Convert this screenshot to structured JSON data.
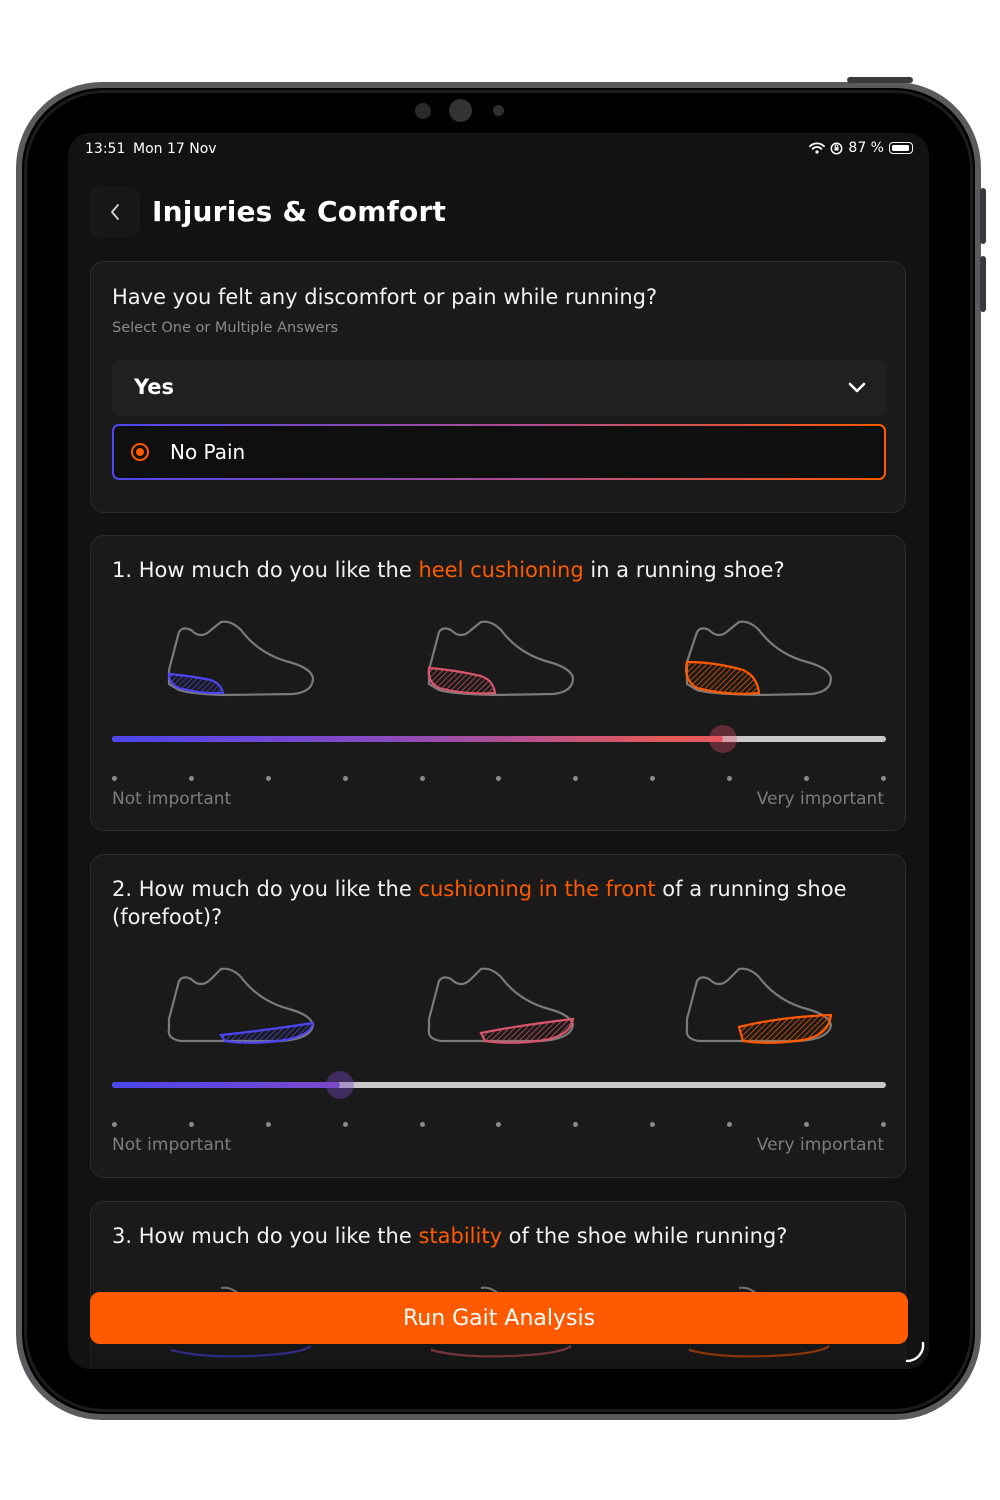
{
  "status_bar": {
    "time": "13:51",
    "date": "Mon 17 Nov",
    "battery": "87 %",
    "icons": [
      "wifi-icon",
      "orientation-lock-icon",
      "battery-icon"
    ]
  },
  "header": {
    "title": "Injuries & Comfort",
    "back_icon": "chevron-left-icon"
  },
  "pain_question": {
    "title": "Have you felt any discomfort or pain while running?",
    "subtitle": "Select One or Multiple Answers",
    "selected": "Yes",
    "option": "No Pain",
    "option_selected": true
  },
  "questions": [
    {
      "number": "1.",
      "pre": "How much do you like the ",
      "highlight": "heel cushioning",
      "post": " in a running shoe?",
      "slider_value_fraction": 0.79,
      "steps": 11,
      "min_label": "Not important",
      "max_label": "Very important"
    },
    {
      "number": "2.",
      "pre": "How much do you like the ",
      "highlight": "cushioning in the front",
      "post": " of a running shoe (forefoot)?",
      "slider_value_fraction": 0.295,
      "steps": 11,
      "min_label": "Not important",
      "max_label": "Very important"
    },
    {
      "number": "3.",
      "pre": "How much do you like the ",
      "highlight": "stability",
      "post": " of the shoe while running?"
    }
  ],
  "cta": {
    "label": "Run Gait Analysis"
  },
  "colors": {
    "accent": "#ff5a00",
    "blue": "#4c46f2",
    "pink": "#d9566a",
    "background": "#121212",
    "card": "#1a1a1a"
  }
}
